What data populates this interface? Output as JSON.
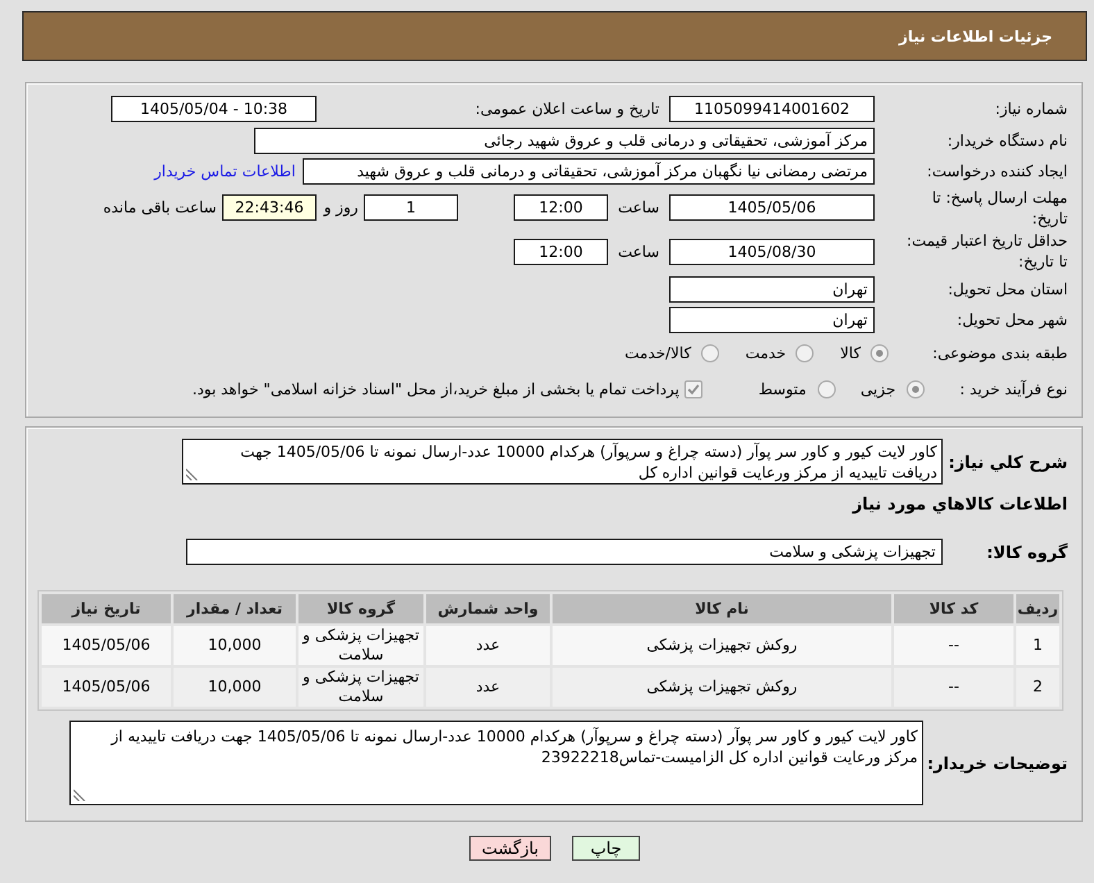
{
  "header": {
    "title": "جزئیات اطلاعات نیاز"
  },
  "details": {
    "need_number": {
      "label": "شماره نیاز:",
      "value": "1105099414001602"
    },
    "announcement": {
      "label": "تاریخ و ساعت اعلان عمومی:",
      "value": "1405/05/04 - 10:38"
    },
    "buyer_org": {
      "label": "نام دستگاه خریدار:",
      "value": "مرکز آموزشی، تحقیقاتی و درمانی قلب و عروق شهید رجائی"
    },
    "requester": {
      "label": "ایجاد کننده درخواست:",
      "value": "مرتضی رمضانی نیا نگهبان مرکز آموزشی، تحقیقاتی و درمانی قلب و عروق شهید",
      "contact_link": "اطلاعات تماس خریدار"
    },
    "response_deadline": {
      "label": "مهلت ارسال پاسخ: تا تاریخ:",
      "date": "1405/05/06",
      "time_label": "ساعت",
      "time": "12:00",
      "days": "1",
      "days_label": "روز و",
      "remaining": "22:43:46",
      "remaining_label": "ساعت باقی مانده"
    },
    "price_validity": {
      "label": "حداقل تاریخ اعتبار قیمت: تا تاریخ:",
      "date": "1405/08/30",
      "time_label": "ساعت",
      "time": "12:00"
    },
    "province": {
      "label": "استان محل تحویل:",
      "value": "تهران"
    },
    "city": {
      "label": "شهر محل تحویل:",
      "value": "تهران"
    },
    "category": {
      "label": "طبقه بندی موضوعی:",
      "disabled": true,
      "options": [
        {
          "label": "کالا",
          "selected": true
        },
        {
          "label": "خدمت",
          "selected": false
        },
        {
          "label": "کالا/خدمت",
          "selected": false
        }
      ]
    },
    "purchase_type": {
      "label": "نوع فرآیند خرید :",
      "disabled": true,
      "options": [
        {
          "label": "جزیی",
          "selected": true
        },
        {
          "label": "متوسط",
          "selected": false
        }
      ],
      "treasury_payment": {
        "label": "پرداخت تمام یا بخشی از مبلغ خرید،از محل \"اسناد خزانه اسلامی\" خواهد بود.",
        "checked": true,
        "disabled": true
      }
    }
  },
  "items": {
    "summary": {
      "label": "شرح کلي نیاز:",
      "value": "کاور لایت کیور  و کاور سر پوآر (دسته چراغ و سرپوآر) هرکدام 10000 عدد-ارسال نمونه تا 1405/05/06 جهت دریافت تاییدیه از مرکز ورعایت قوانین اداره کل"
    },
    "heading": "اطلاعات کالاهاي مورد نیاز",
    "goods_group": {
      "label": "گروه کالا:",
      "value": "تجهیزات پزشکی و سلامت"
    },
    "table": {
      "columns": [
        "ردیف",
        "کد کالا",
        "نام کالا",
        "واحد شمارش",
        "گروه کالا",
        "تعداد / مقدار",
        "تاریخ نیاز"
      ],
      "rows": [
        [
          "1",
          "--",
          "روکش تجهیزات پزشکی",
          "عدد",
          "تجهیزات پزشکی و سلامت",
          "10,000",
          "1405/05/06"
        ],
        [
          "2",
          "--",
          "روکش تجهیزات پزشکی",
          "عدد",
          "تجهیزات پزشکی و سلامت",
          "10,000",
          "1405/05/06"
        ]
      ]
    },
    "buyer_notes": {
      "label": "توضیحات خریدار:",
      "value": "کاور لایت کیور  و کاور سر پوآر (دسته چراغ و سرپوآر) هرکدام 10000 عدد-ارسال نمونه تا 1405/05/06 جهت دریافت تاییدیه از مرکز ورعایت قوانین اداره کل الزامیست-تماس23922218"
    }
  },
  "buttons": [
    {
      "label": "چاپ",
      "kind": "print"
    },
    {
      "label": "بازگشت",
      "kind": "back"
    }
  ]
}
